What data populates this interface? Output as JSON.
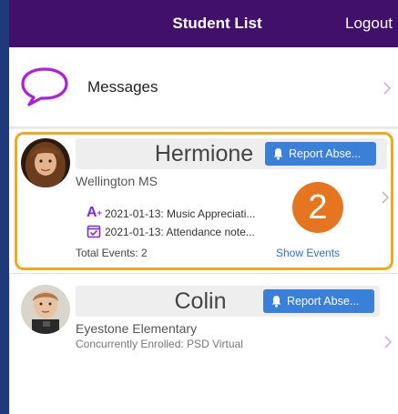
{
  "nav": {
    "title": "Student List",
    "logout": "Logout"
  },
  "messages": {
    "label": "Messages"
  },
  "students": [
    {
      "name": "Hermione",
      "report_label": "Report Abse...",
      "school": "Wellington MS",
      "events": [
        {
          "icon": "grade-a-icon",
          "text": "2021-01-13: Music Appreciati..."
        },
        {
          "icon": "calendar-check-icon",
          "text": "2021-01-13: Attendance note..."
        }
      ],
      "total_events": "Total Events: 2",
      "show_events": "Show Events",
      "badge": "2"
    },
    {
      "name": "Colin",
      "report_label": "Report Abse...",
      "school": "Eyestone Elementary",
      "enrollment": "Concurrently Enrolled: PSD Virtual"
    }
  ],
  "colors": {
    "nav_bg": "#40106b",
    "highlight_border": "#f0a91b",
    "badge": "#e5751f",
    "button": "#3a7fd8",
    "link": "#2f6fc7",
    "chevron": "#c9a8d8"
  }
}
